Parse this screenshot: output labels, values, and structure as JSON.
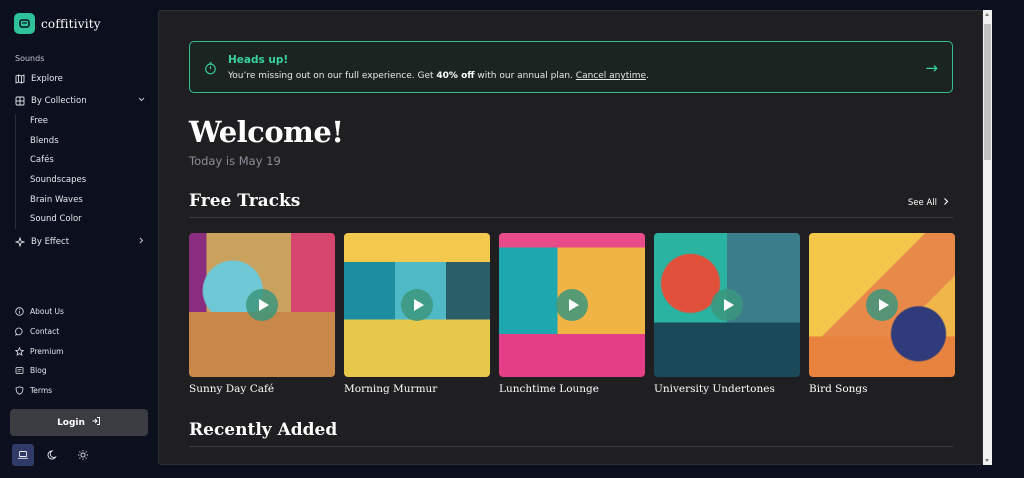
{
  "brand": {
    "name": "coffitivity",
    "logo_icon": "coffee-cup-icon",
    "logo_color": "#2fc29a"
  },
  "sidebar": {
    "section_title": "Sounds",
    "items": [
      {
        "label": "Explore",
        "icon": "map-icon"
      },
      {
        "label": "By Collection",
        "icon": "grid-icon",
        "chevron": "chevron-down-icon"
      },
      {
        "label": "By Effect",
        "icon": "sparkle-icon",
        "chevron": "chevron-right-icon"
      }
    ],
    "collection_items": [
      "Free",
      "Blends",
      "Cafés",
      "Soundscapes",
      "Brain Waves",
      "Sound Color"
    ],
    "footer_items": [
      {
        "label": "About Us",
        "icon": "info-icon"
      },
      {
        "label": "Contact",
        "icon": "chat-icon"
      },
      {
        "label": "Premium",
        "icon": "star-icon"
      },
      {
        "label": "Blog",
        "icon": "news-icon"
      },
      {
        "label": "Terms",
        "icon": "shield-icon"
      }
    ],
    "login_label": "Login",
    "theme_options": [
      "laptop-icon",
      "moon-icon",
      "sun-icon"
    ]
  },
  "banner": {
    "title": "Heads up!",
    "text_before": "You’re missing out on our full experience. Get ",
    "text_bold": "40% off",
    "text_after": " with our annual plan. ",
    "link": "Cancel anytime",
    "link_after": ".",
    "accent": "#37d3a0"
  },
  "welcome": {
    "title": "Welcome!",
    "date": "Today is May 19"
  },
  "free_tracks": {
    "title": "Free Tracks",
    "see_all": "See All",
    "tracks": [
      {
        "title": "Sunny Day Café"
      },
      {
        "title": "Morning Murmur"
      },
      {
        "title": "Lunchtime Lounge"
      },
      {
        "title": "University Undertones"
      },
      {
        "title": "Bird Songs"
      }
    ]
  },
  "recently_added": {
    "title": "Recently Added"
  }
}
